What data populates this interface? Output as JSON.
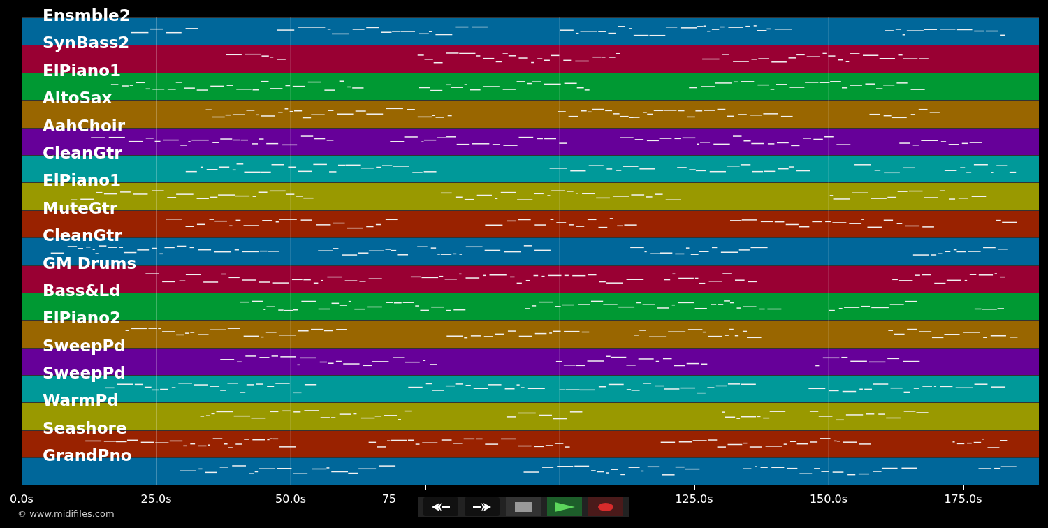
{
  "tracks": [
    {
      "name": "Ensmble2",
      "color": "#00679a"
    },
    {
      "name": "SynBass2",
      "color": "#990033"
    },
    {
      "name": "ElPiano1",
      "color": "#009933"
    },
    {
      "name": "AltoSax",
      "color": "#996600"
    },
    {
      "name": "AahChoir",
      "color": "#660099"
    },
    {
      "name": "CleanGtr",
      "color": "#009999"
    },
    {
      "name": "ElPiano1",
      "color": "#999900"
    },
    {
      "name": "MuteGtr",
      "color": "#992200"
    },
    {
      "name": "CleanGtr",
      "color": "#00679a"
    },
    {
      "name": "GM Drums",
      "color": "#990033"
    },
    {
      "name": "Bass&Ld",
      "color": "#009933"
    },
    {
      "name": "ElPiano2",
      "color": "#996600"
    },
    {
      "name": "SweepPd",
      "color": "#660099"
    },
    {
      "name": "SweepPd",
      "color": "#009999"
    },
    {
      "name": "WarmPd",
      "color": "#999900"
    },
    {
      "name": "Seashore",
      "color": "#992200"
    },
    {
      "name": "GrandPno",
      "color": "#00679a"
    }
  ],
  "axis_ticks": [
    "0.0s",
    "25.0s",
    "50.0s",
    "75",
    "125.0s",
    "150.0s",
    "175.0s"
  ],
  "copyright": "© www.midifiles.com",
  "transport": [
    {
      "kind": "rewind"
    },
    {
      "kind": "forward"
    },
    {
      "kind": "stop"
    },
    {
      "kind": "play"
    },
    {
      "kind": "record"
    }
  ]
}
